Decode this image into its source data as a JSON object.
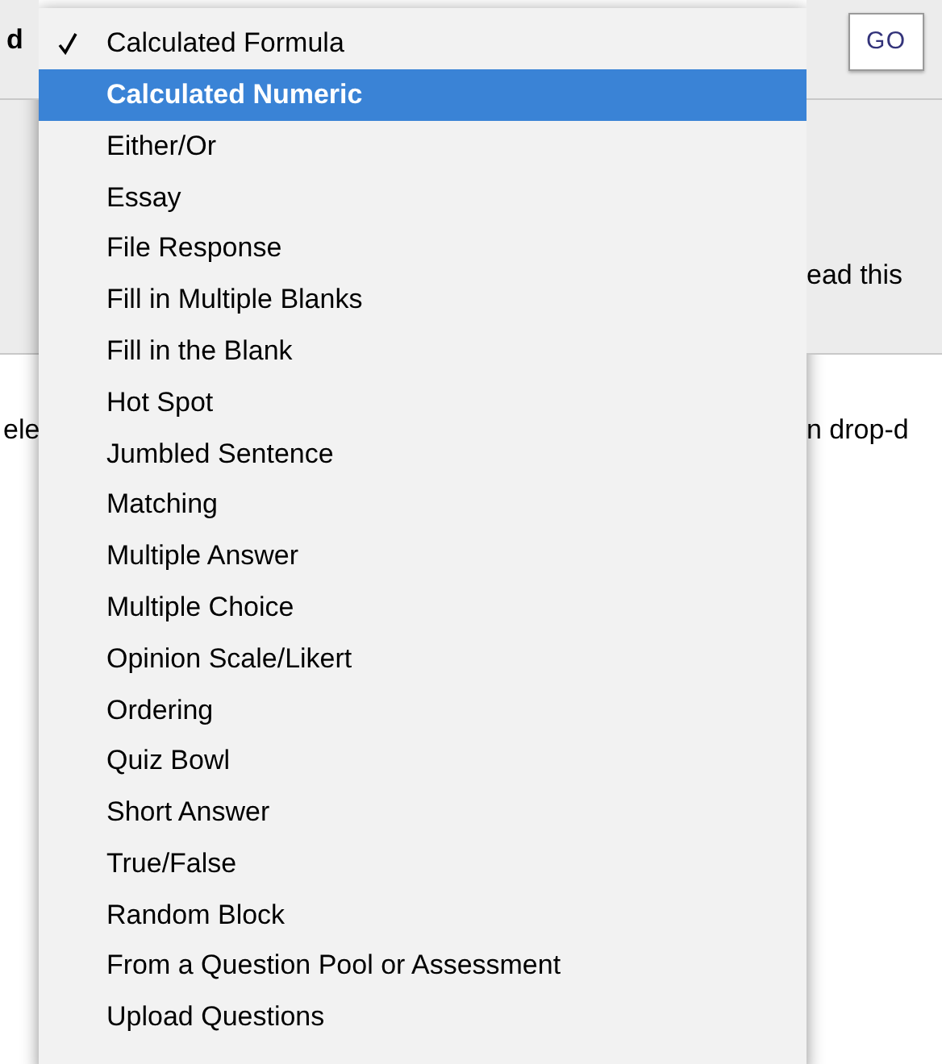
{
  "background": {
    "left_fragments": [
      "d",
      "ele"
    ],
    "go_button": "GO",
    "right_fragments": [
      "ead this",
      "n drop-d"
    ]
  },
  "menu": {
    "items": [
      {
        "label": "Calculated Formula",
        "checked": true,
        "selected": false
      },
      {
        "label": "Calculated Numeric",
        "checked": false,
        "selected": true
      },
      {
        "label": "Either/Or",
        "checked": false,
        "selected": false
      },
      {
        "label": "Essay",
        "checked": false,
        "selected": false
      },
      {
        "label": "File Response",
        "checked": false,
        "selected": false
      },
      {
        "label": "Fill in Multiple Blanks",
        "checked": false,
        "selected": false
      },
      {
        "label": "Fill in the Blank",
        "checked": false,
        "selected": false
      },
      {
        "label": "Hot Spot",
        "checked": false,
        "selected": false
      },
      {
        "label": "Jumbled Sentence",
        "checked": false,
        "selected": false
      },
      {
        "label": "Matching",
        "checked": false,
        "selected": false
      },
      {
        "label": "Multiple Answer",
        "checked": false,
        "selected": false
      },
      {
        "label": "Multiple Choice",
        "checked": false,
        "selected": false
      },
      {
        "label": "Opinion Scale/Likert",
        "checked": false,
        "selected": false
      },
      {
        "label": "Ordering",
        "checked": false,
        "selected": false
      },
      {
        "label": "Quiz Bowl",
        "checked": false,
        "selected": false
      },
      {
        "label": "Short Answer",
        "checked": false,
        "selected": false
      },
      {
        "label": "True/False",
        "checked": false,
        "selected": false
      },
      {
        "label": "Random Block",
        "checked": false,
        "selected": false
      },
      {
        "label": "From a Question Pool or Assessment",
        "checked": false,
        "selected": false
      },
      {
        "label": "Upload Questions",
        "checked": false,
        "selected": false
      }
    ]
  }
}
